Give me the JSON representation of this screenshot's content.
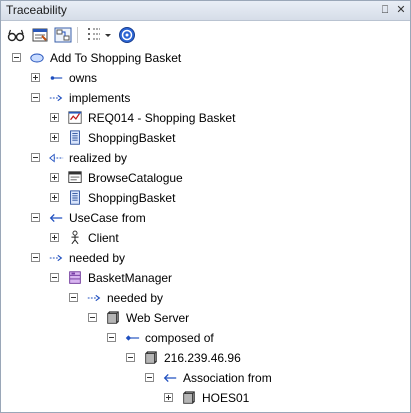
{
  "window": {
    "title": "Traceability",
    "pin_glyph": "⎕",
    "close_glyph": "✕"
  },
  "toolbar": {
    "items": [
      "glasses-icon",
      "properties-icon",
      "navigate-icon",
      "filter-icon",
      "dropdown-arrow-icon",
      "help-icon"
    ]
  },
  "tree": {
    "nodes": [
      {
        "label": "Add To Shopping Basket",
        "depth": 0,
        "expander": "minus",
        "icon": "use-case-icon"
      },
      {
        "label": "owns",
        "depth": 1,
        "expander": "plus",
        "icon": "association-arrow-icon"
      },
      {
        "label": "implements",
        "depth": 1,
        "expander": "minus",
        "icon": "dependency-arrow-icon"
      },
      {
        "label": "REQ014 - Shopping Basket",
        "depth": 2,
        "expander": "plus",
        "icon": "requirement-icon"
      },
      {
        "label": "ShoppingBasket",
        "depth": 2,
        "expander": "plus",
        "icon": "component-icon"
      },
      {
        "label": "realized by",
        "depth": 1,
        "expander": "minus",
        "icon": "realization-arrow-icon"
      },
      {
        "label": "BrowseCatalogue",
        "depth": 2,
        "expander": "plus",
        "icon": "screen-icon"
      },
      {
        "label": "ShoppingBasket",
        "depth": 2,
        "expander": "plus",
        "icon": "component-icon"
      },
      {
        "label": "UseCase from",
        "depth": 1,
        "expander": "minus",
        "icon": "usecase-link-arrow-icon"
      },
      {
        "label": "Client",
        "depth": 2,
        "expander": "plus",
        "icon": "actor-icon"
      },
      {
        "label": "needed by",
        "depth": 1,
        "expander": "minus",
        "icon": "dependency-arrow-icon"
      },
      {
        "label": "BasketManager",
        "depth": 2,
        "expander": "minus",
        "icon": "class-icon"
      },
      {
        "label": "needed by",
        "depth": 3,
        "expander": "minus",
        "icon": "dependency-arrow-icon"
      },
      {
        "label": "Web Server",
        "depth": 4,
        "expander": "minus",
        "icon": "node-icon"
      },
      {
        "label": "composed of",
        "depth": 5,
        "expander": "minus",
        "icon": "composition-arrow-icon"
      },
      {
        "label": "216.239.46.96",
        "depth": 6,
        "expander": "minus",
        "icon": "node-icon"
      },
      {
        "label": "Association from",
        "depth": 7,
        "expander": "minus",
        "icon": "association-from-arrow-icon"
      },
      {
        "label": "HOES01",
        "depth": 8,
        "expander": "plus",
        "icon": "node-icon"
      }
    ]
  },
  "colors": {
    "accent_blue": "#1f4fbf",
    "titlebar": "#dde3ec",
    "purple": "#7a3fa8"
  }
}
